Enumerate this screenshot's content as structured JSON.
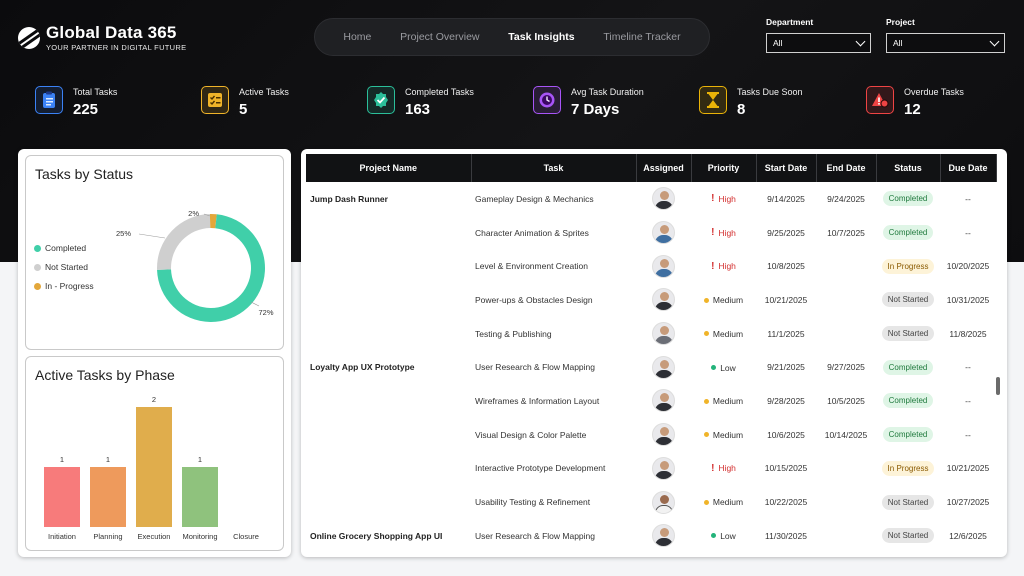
{
  "brand": {
    "title": "Global Data 365",
    "tagline": "YOUR PARTNER IN DIGITAL FUTURE"
  },
  "nav": {
    "items": [
      "Home",
      "Project Overview",
      "Task Insights",
      "Timeline Tracker"
    ],
    "active": "Task Insights"
  },
  "filters": {
    "department": {
      "label": "Department",
      "value": "All"
    },
    "project": {
      "label": "Project",
      "value": "All"
    }
  },
  "kpis": [
    {
      "label": "Total Tasks",
      "value": "225",
      "icon": "clipboard-list-icon",
      "color": "#3b82f6"
    },
    {
      "label": "Active Tasks",
      "value": "5",
      "icon": "checklist-icon",
      "color": "#f0b429"
    },
    {
      "label": "Completed Tasks",
      "value": "163",
      "icon": "badge-check-icon",
      "color": "#2bbf9a"
    },
    {
      "label": "Avg Task Duration",
      "value": "7 Days",
      "icon": "clock-icon",
      "color": "#a855f7"
    },
    {
      "label": "Tasks Due Soon",
      "value": "8",
      "icon": "hourglass-icon",
      "color": "#eab308"
    },
    {
      "label": "Overdue Tasks",
      "value": "12",
      "icon": "alert-icon",
      "color": "#ef4444"
    }
  ],
  "status_chart": {
    "title": "Tasks by Status",
    "legend": [
      "Completed",
      "Not Started",
      "In - Progress"
    ],
    "labels": [
      "72%",
      "25%",
      "2%"
    ]
  },
  "phase_chart": {
    "title": "Active Tasks by Phase"
  },
  "chart_data": [
    {
      "type": "pie",
      "title": "Tasks by Status",
      "categories": [
        "Completed",
        "Not Started",
        "In - Progress"
      ],
      "values": [
        72,
        25,
        2
      ],
      "colors": [
        "#40cfa9",
        "#cfcfcf",
        "#e3a73b"
      ],
      "legend": "left"
    },
    {
      "type": "bar",
      "title": "Active Tasks by Phase",
      "categories": [
        "Initiation",
        "Planning",
        "Execution",
        "Monitoring",
        "Closure"
      ],
      "values": [
        1,
        1,
        2,
        1,
        0
      ],
      "colors": [
        "#f77b7b",
        "#ee9a5c",
        "#e0ad4c",
        "#8fc27d",
        "#cccccc"
      ],
      "ylim": [
        0,
        2
      ]
    }
  ],
  "table": {
    "headers": [
      "Project Name",
      "Task",
      "Assigned",
      "Priority",
      "Start Date",
      "End Date",
      "Status",
      "Due Date"
    ],
    "rows": [
      {
        "project": "Jump Dash Runner",
        "task": "Gameplay Design & Mechanics",
        "avatar": "m",
        "priority": "High",
        "start": "9/14/2025",
        "end": "9/24/2025",
        "status": "Completed",
        "due": "--"
      },
      {
        "project": "",
        "task": "Character Animation & Sprites",
        "avatar": "blue",
        "priority": "High",
        "start": "9/25/2025",
        "end": "10/7/2025",
        "status": "Completed",
        "due": "--"
      },
      {
        "project": "",
        "task": "Level & Environment Creation",
        "avatar": "blue",
        "priority": "High",
        "start": "10/8/2025",
        "end": "",
        "status": "In Progress",
        "due": "10/20/2025"
      },
      {
        "project": "",
        "task": "Power-ups & Obstacles Design",
        "avatar": "m",
        "priority": "Medium",
        "start": "10/21/2025",
        "end": "",
        "status": "Not Started",
        "due": "10/31/2025"
      },
      {
        "project": "",
        "task": "Testing & Publishing",
        "avatar": "grey",
        "priority": "Medium",
        "start": "11/1/2025",
        "end": "",
        "status": "Not Started",
        "due": "11/8/2025"
      },
      {
        "project": "Loyalty App UX Prototype",
        "task": "User Research & Flow Mapping",
        "avatar": "m",
        "priority": "Low",
        "start": "9/21/2025",
        "end": "9/27/2025",
        "status": "Completed",
        "due": "--"
      },
      {
        "project": "",
        "task": "Wireframes & Information Layout",
        "avatar": "m",
        "priority": "Medium",
        "start": "9/28/2025",
        "end": "10/5/2025",
        "status": "Completed",
        "due": "--"
      },
      {
        "project": "",
        "task": "Visual Design & Color Palette",
        "avatar": "m",
        "priority": "Medium",
        "start": "10/6/2025",
        "end": "10/14/2025",
        "status": "Completed",
        "due": "--"
      },
      {
        "project": "",
        "task": "Interactive Prototype Development",
        "avatar": "m",
        "priority": "High",
        "start": "10/15/2025",
        "end": "",
        "status": "In Progress",
        "due": "10/21/2025"
      },
      {
        "project": "",
        "task": "Usability Testing & Refinement",
        "avatar": "f",
        "priority": "Medium",
        "start": "10/22/2025",
        "end": "",
        "status": "Not Started",
        "due": "10/27/2025"
      },
      {
        "project": "Online Grocery Shopping App UI",
        "task": "User Research & Flow Mapping",
        "avatar": "m",
        "priority": "Low",
        "start": "11/30/2025",
        "end": "",
        "status": "Not Started",
        "due": "12/6/2025"
      }
    ]
  }
}
